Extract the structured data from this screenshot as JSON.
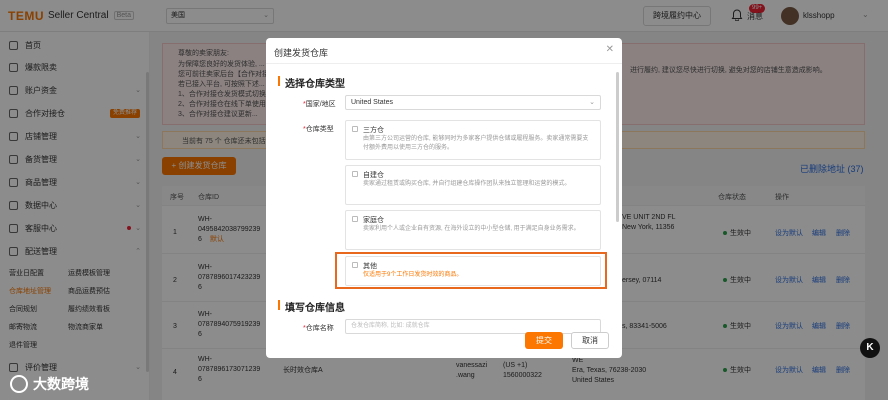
{
  "topbar": {
    "brand": "TEMU",
    "product": "Seller Central",
    "beta": "Beta",
    "region": "美国",
    "cross_border_btn": "跨境履约中心",
    "msg_badge": "99+",
    "msg_label": "消息",
    "username": "klsshopp"
  },
  "sidebar": {
    "items": [
      {
        "label": "首页"
      },
      {
        "label": "爆款限卖"
      },
      {
        "label": "账户资金"
      },
      {
        "label": "合作对接仓",
        "tag": "免费推荐"
      },
      {
        "label": "店铺管理"
      },
      {
        "label": "备货管理"
      },
      {
        "label": "商品管理"
      },
      {
        "label": "数据中心"
      },
      {
        "label": "客服中心"
      },
      {
        "label": "配送管理"
      }
    ],
    "sub_items": [
      [
        "营业日配置",
        "运费模板管理"
      ],
      [
        "仓库地址管理",
        "商品运费预估"
      ],
      [
        "合同规划",
        "履约绩效看板"
      ],
      [
        "邮寄物流",
        "物流商家单"
      ],
      [
        "退件管理",
        ""
      ]
    ],
    "bottom_item": "评价管理"
  },
  "notice": {
    "lines": [
      "尊敬的卖家朋友:",
      "为保障您良好的发货体验, ...",
      "您可前往卖家后台【合作对接...",
      "若已接入平台, 可按照下述...",
      "1、合作对接仓发货模式切换...",
      "2、合作对接仓在线下单使用...",
      "3、合作对接仓建议更新..."
    ],
    "right_text": "进行履约, 建议您尽快进行切换, 避免对您的店铺生意造成影响。",
    "warn_text": "当前有 75 个 仓库还未包括..."
  },
  "main": {
    "create_btn": "+ 创建发货仓库",
    "deleted_link": "已删除地址 (37)",
    "headers": [
      "序号",
      "仓库ID",
      "仓库状态",
      "操作"
    ],
    "rows": [
      {
        "no": "1",
        "id": "WH-\n0495842038799239\n6",
        "tag": "默认",
        "addr": "VE UNIT 2ND FL\nNew York, 11356",
        "status": "生效中",
        "actions": [
          "设为默认",
          "编辑",
          "删除"
        ]
      },
      {
        "no": "2",
        "id": "WH-\n0787896017423239\n6",
        "tag": "",
        "addr": "ersey, 07114",
        "status": "生效中",
        "actions": [
          "设为默认",
          "编辑",
          "删除"
        ]
      },
      {
        "no": "3",
        "id": "WH-\n0787894075919239\n6",
        "tag": "",
        "addr": "s, 83341-5006",
        "status": "生效中",
        "actions": [
          "设为默认",
          "编辑",
          "删除"
        ]
      },
      {
        "no": "4",
        "id": "WH-\n0787896173071239\n6",
        "tag": "",
        "name": "长时效仓库A",
        "contact": "vanessazi\n.wang",
        "phone": "(US +1)\n1560000322",
        "addr": "WE\nEra, Texas, 76238-2030\nUnited States",
        "status": "生效中",
        "actions": [
          "设为默认",
          "编辑",
          "删除"
        ]
      }
    ]
  },
  "modal": {
    "title": "创建发货仓库",
    "section1": "选择仓库类型",
    "country_label": "国家/地区",
    "country_value": "United States",
    "type_label": "仓库类型",
    "options": [
      {
        "title": "三方仓",
        "desc": "由第三方公司运营的仓库, 能够同时为多家客户提供仓储或履程服务。卖家通常需要支付额外费用以使用三方仓的服务。"
      },
      {
        "title": "自建仓",
        "desc": "卖家通过租赁或购买仓库, 并自行组建仓库操作团队来独立管理和运营的模式。"
      },
      {
        "title": "家庭仓",
        "desc": "卖家利用个人或企业自有资源, 在海外设立的中小型仓储, 用于满足自身业务需求。"
      },
      {
        "title": "其他",
        "desc": "仅适用于9个工作日发货时效的商品。"
      }
    ],
    "section2": "填写仓库信息",
    "name_label": "仓库名称",
    "name_placeholder": "仓发仓库简称, 比如: 成就仓库",
    "submit": "提交",
    "cancel": "取消"
  },
  "watermark": "大数跨境",
  "corner_badge": "K"
}
